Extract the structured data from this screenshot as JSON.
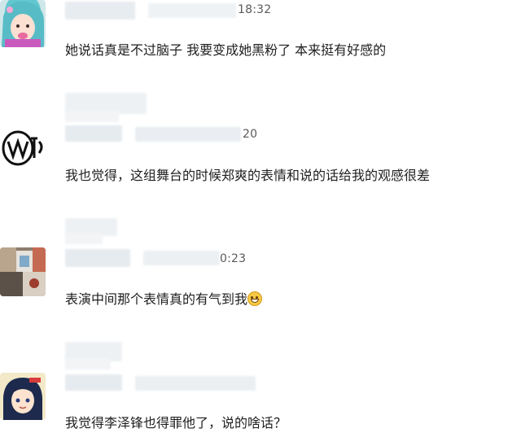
{
  "comments": [
    {
      "avatar_icon": "cartoon-girl-blue-hair-avatar",
      "timestamp": "18:32",
      "text": "她说话真是不过脑子 我要变成她黑粉了 本来挺有好感的"
    },
    {
      "avatar_icon": "hand-drawn-logo-avatar",
      "timestamp": "20",
      "text": "我也觉得，这组舞台的时候郑爽的表情和说的话给我的观感很差"
    },
    {
      "avatar_icon": "photo-collage-avatar",
      "timestamp": "0:23",
      "text": "表演中间那个表情真的有气到我",
      "emoji": "grinning-face-emoji"
    },
    {
      "avatar_icon": "anime-character-avatar",
      "timestamp": "",
      "text": "我觉得李泽锋也得罪他了，说的啥话？"
    }
  ],
  "colors": {
    "blur_light": "#e9eef2",
    "blur_mid": "#dfe5ea",
    "text": "#1f1f1f",
    "timestamp": "#5a5a5a"
  }
}
